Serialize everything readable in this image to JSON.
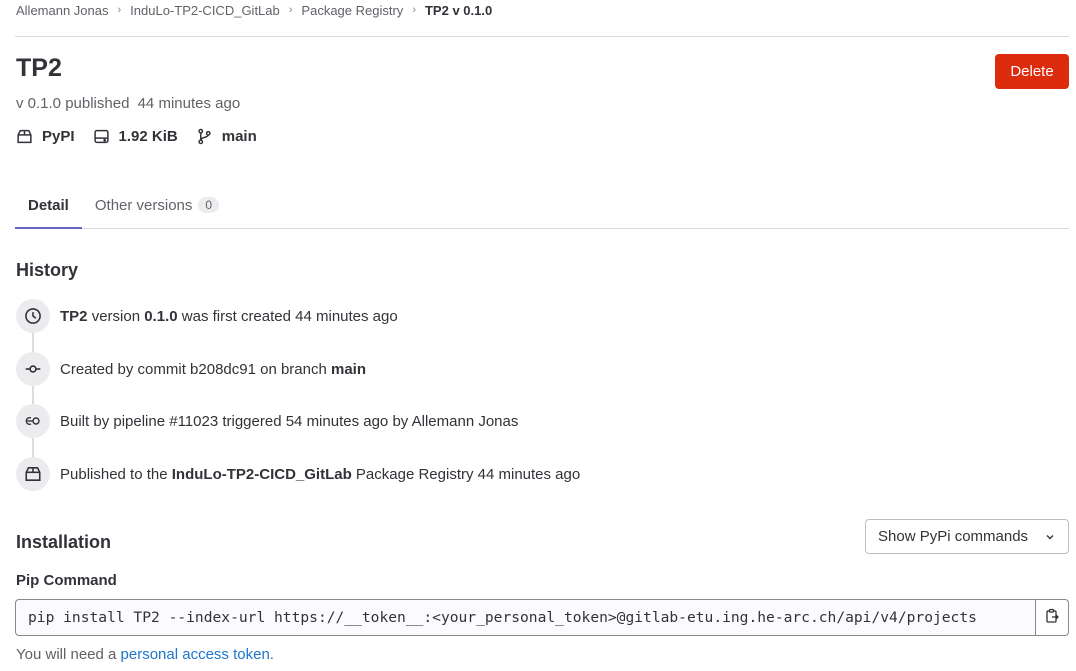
{
  "breadcrumb": {
    "items": [
      "Allemann Jonas",
      "InduLo-TP2-CICD_GitLab",
      "Package Registry",
      "TP2 v 0.1.0"
    ]
  },
  "header": {
    "title": "TP2",
    "delete_label": "Delete",
    "published_prefix": "v 0.1.0 published",
    "published_time": "44 minutes ago"
  },
  "meta": {
    "type": "PyPI",
    "size": "1.92 KiB",
    "branch": "main"
  },
  "tabs": {
    "detail": "Detail",
    "other_versions": "Other versions",
    "other_versions_count": "0"
  },
  "history": {
    "title": "History",
    "item1": {
      "name": "TP2",
      "t1": "version",
      "version": "0.1.0",
      "t2": "was first created 44 minutes ago"
    },
    "item2": {
      "t1": "Created by commit b208dc91 on branch",
      "branch": "main"
    },
    "item3": {
      "text": "Built by pipeline #11023 triggered 54 minutes ago by Allemann Jonas"
    },
    "item4": {
      "t1": "Published to the",
      "project": "InduLo-TP2-CICD_GitLab",
      "t2": "Package Registry 44 minutes ago"
    }
  },
  "installation": {
    "title": "Installation",
    "dropdown_label": "Show PyPi commands",
    "pip_label": "Pip Command",
    "pip_command": "pip install TP2 --index-url https://__token__:<your_personal_token>@gitlab-etu.ing.he-arc.ch/api/v4/projects",
    "help_prefix": "You will need a",
    "help_link": "personal access token",
    "help_suffix": "."
  },
  "colors": {
    "danger": "#dd2b0e",
    "tab_active": "#6666c4",
    "link": "#1f75cb"
  },
  "icons": [
    "package-icon",
    "disk-icon",
    "branch-icon",
    "clock-icon",
    "commit-icon",
    "pipeline-icon",
    "package-icon",
    "chevron-down-icon",
    "copy-icon"
  ]
}
